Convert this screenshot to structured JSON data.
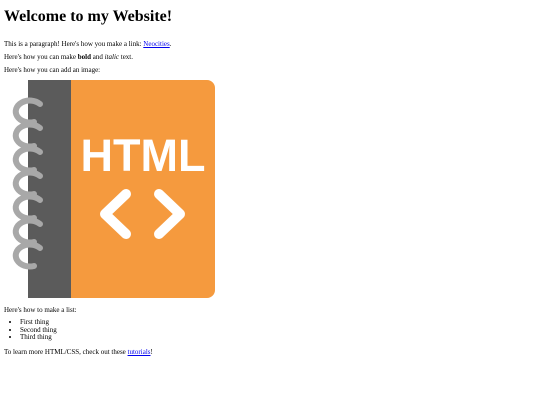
{
  "title": "Welcome to my Website!",
  "intro": {
    "before": "This is a paragraph! Here's how you make a link: ",
    "link_text": "Neocities",
    "after": "."
  },
  "format": {
    "before": "Here's how you can make ",
    "bold": "bold",
    "middle": " and ",
    "italic": "italic",
    "after": " text."
  },
  "image_caption": "Here's how you can add an image:",
  "image": {
    "text": "HTML",
    "glyph": "<>",
    "colors": {
      "cover": "#f59a3e",
      "spine": "#5b5b5b",
      "rings": "#a8a8a8",
      "text": "#ffffff"
    }
  },
  "list_intro": "Here's how to make a list:",
  "list_items": [
    "First thing",
    "Second thing",
    "Third thing"
  ],
  "outro": {
    "before": "To learn more HTML/CSS, check out these ",
    "link_text": "tutorials",
    "after": "!"
  }
}
